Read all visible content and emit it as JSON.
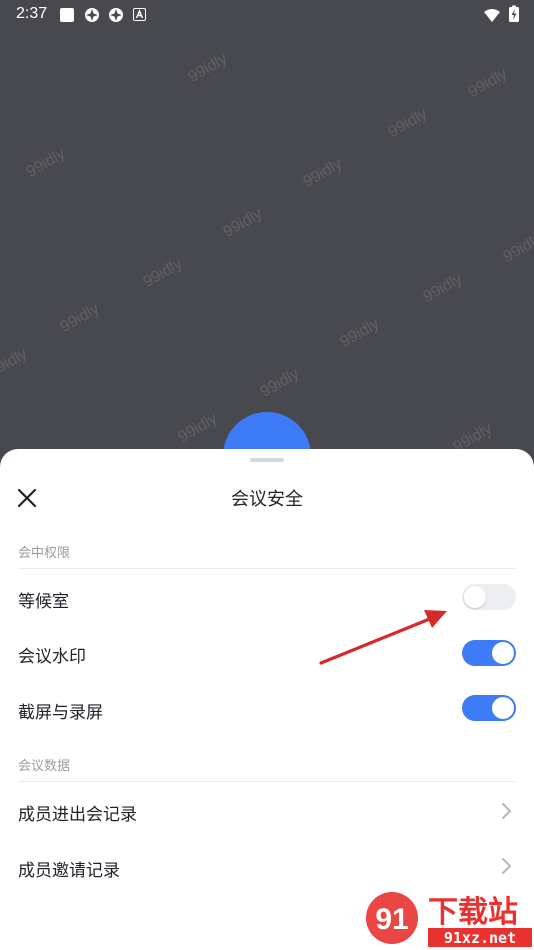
{
  "status_bar": {
    "time": "2:37"
  },
  "watermark_text": "99idly",
  "sheet": {
    "title": "会议安全",
    "sections": [
      {
        "label": "会中权限"
      },
      {
        "label": "会议数据"
      }
    ],
    "toggles": [
      {
        "label": "等候室",
        "on": false
      },
      {
        "label": "会议水印",
        "on": true
      },
      {
        "label": "截屏与录屏",
        "on": true
      }
    ],
    "links": [
      {
        "label": "成员进出会记录"
      },
      {
        "label": "成员邀请记录"
      }
    ]
  },
  "brand_logo": {
    "main": "下载站",
    "sub": "91xz.net",
    "mark": "91"
  },
  "colors": {
    "accent": "#3e7cf7",
    "arrow": "#d42a2a",
    "logo_red": "#e8322f"
  }
}
